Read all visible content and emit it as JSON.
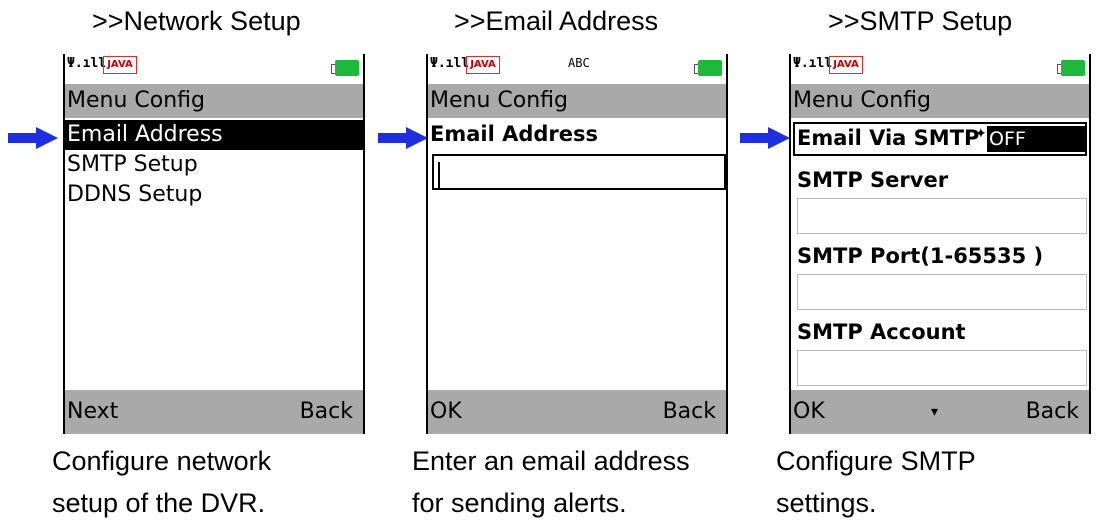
{
  "headings": [
    ">>Network Setup",
    ">>Email Address",
    ">>SMTP Setup"
  ],
  "status": {
    "java_label": "JAVA",
    "input_mode": "ABC"
  },
  "screen1": {
    "title": "Menu Config",
    "items": [
      "Email Address",
      "SMTP Setup",
      "DDNS Setup"
    ],
    "soft_left": "Next",
    "soft_right": "Back"
  },
  "screen2": {
    "title": "Menu Config",
    "label": "Email Address",
    "value": "",
    "soft_left": "OK",
    "soft_right": "Back"
  },
  "screen3": {
    "title": "Menu Config",
    "email_via_smtp_label": "Email Via SMTP",
    "email_via_smtp_value": "OFF",
    "smtp_server_label": "SMTP Server",
    "smtp_port_label": "SMTP Port(1-65535 )",
    "smtp_account_label": "SMTP Account",
    "soft_left": "OK",
    "soft_right": "Back"
  },
  "captions": [
    [
      "Configure network",
      "setup of the DVR."
    ],
    [
      "Enter an email address",
      "for sending alerts."
    ],
    [
      "Configure SMTP",
      "settings."
    ]
  ],
  "colors": {
    "arrow": "#1f2fe0",
    "bar": "#a9a9a9",
    "battery": "#1db93b"
  }
}
